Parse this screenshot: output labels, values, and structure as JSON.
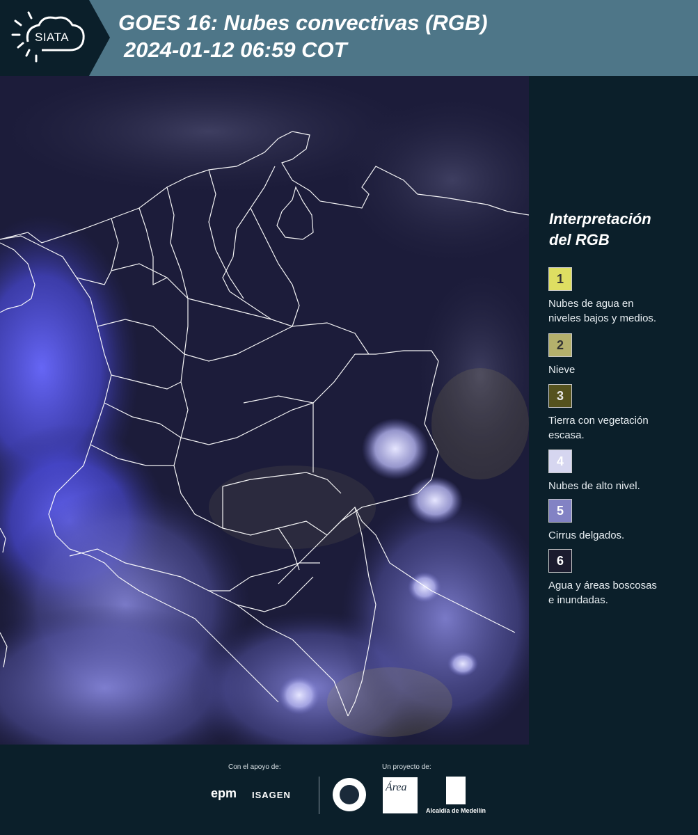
{
  "header": {
    "logo_text": "SIATA",
    "title": "GOES 16: Nubes convectivas (RGB)",
    "subtitle": "2024-01-12 06:59 COT"
  },
  "legend": {
    "title_line1": "Interpretación",
    "title_line2": "del RGB",
    "items": [
      {
        "number": "1",
        "color": "#dede62",
        "label_line1": "Nubes de agua en",
        "label_line2": "niveles bajos y medios."
      },
      {
        "number": "2",
        "color": "#b4b06c",
        "label_line1": "Nieve",
        "label_line2": ""
      },
      {
        "number": "3",
        "color": "#55521e",
        "label_line1": "Tierra con vegetación",
        "label_line2": "escasa."
      },
      {
        "number": "4",
        "color": "#d6d6f0",
        "label_line1": "Nubes de alto nivel.",
        "label_line2": ""
      },
      {
        "number": "5",
        "color": "#8282c4",
        "label_line1": "Cirrus delgados.",
        "label_line2": ""
      },
      {
        "number": "6",
        "color": "#1b1b2e",
        "label_line1": "Agua y áreas boscosas",
        "label_line2": "e inundadas."
      }
    ]
  },
  "footer": {
    "support_label": "Con el apoyo de:",
    "project_label": "Un proyecto de:",
    "sponsor1": "epm",
    "sponsor2": "ISAGEN",
    "partner1": "Área",
    "partner2": "Alcaldía de Medellín"
  },
  "colors": {
    "header_bg": "#4e7688",
    "logo_bg": "#0b1f2a",
    "page_bg": "#0b1f2a",
    "map_dark": "#1a1a38",
    "cloud_blue": "#5a5ae6",
    "border_line": "#ffffff"
  }
}
